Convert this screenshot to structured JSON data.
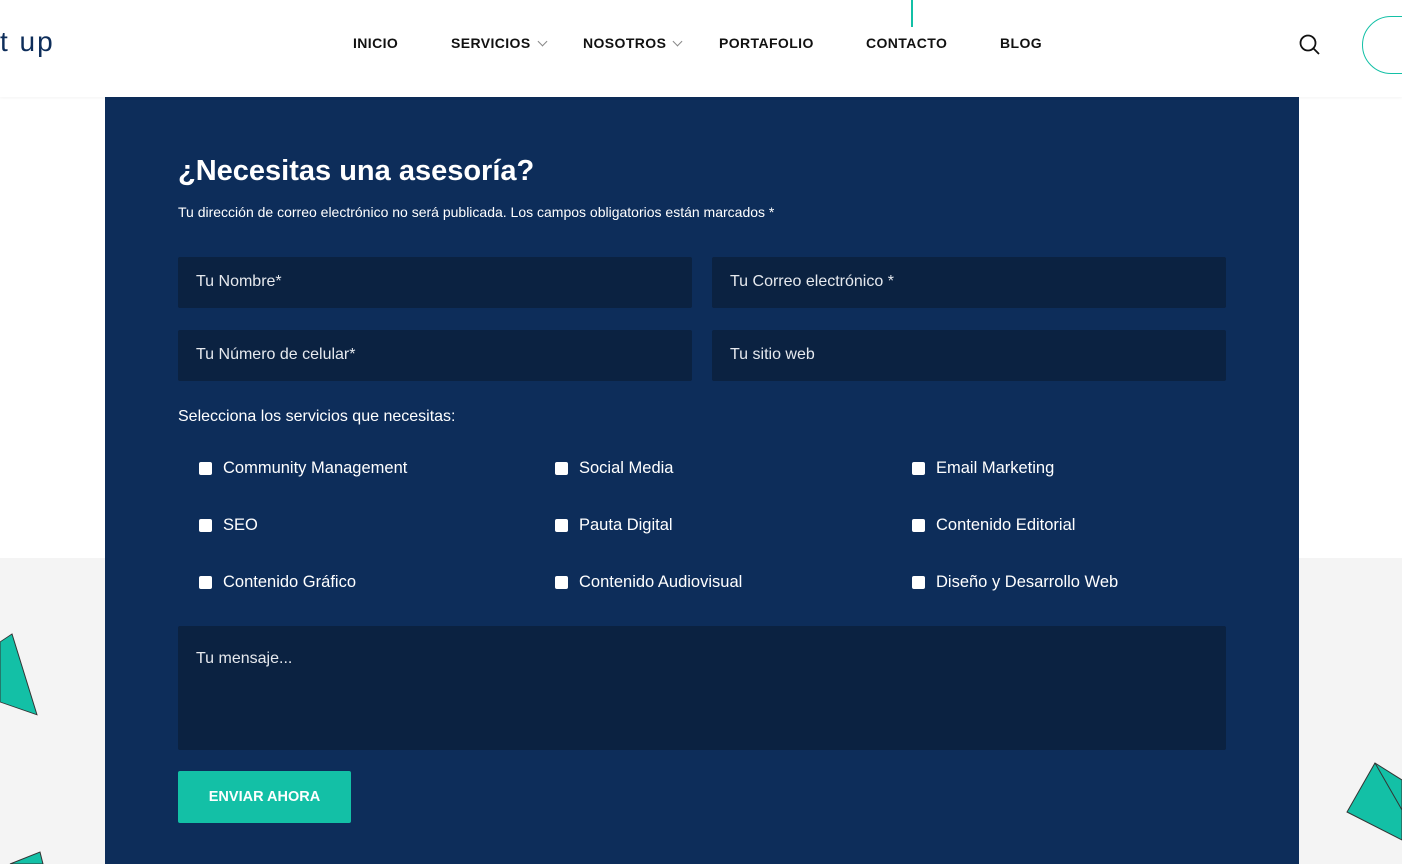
{
  "header": {
    "logo": "t up",
    "nav": [
      {
        "label": "INICIO"
      },
      {
        "label": "SERVICIOS"
      },
      {
        "label": "NOSOTROS"
      },
      {
        "label": "PORTAFOLIO"
      },
      {
        "label": "CONTACTO"
      },
      {
        "label": "BLOG"
      }
    ]
  },
  "form": {
    "title": "¿Necesitas una asesoría?",
    "note": "Tu dirección de correo electrónico no será publicada. Los campos obligatorios están marcados *",
    "name_placeholder": "Tu Nombre*",
    "email_placeholder": "Tu Correo electrónico *",
    "phone_placeholder": "Tu Número de celular*",
    "web_placeholder": "Tu sitio web",
    "services_label": "Selecciona los servicios que necesitas:",
    "services": [
      "Community Management",
      "Social Media",
      "Email Marketing",
      "SEO",
      "Pauta Digital",
      "Contenido Editorial",
      "Contenido Gráfico",
      "Contenido Audiovisual",
      "Diseño y Desarrollo Web"
    ],
    "message_placeholder": "Tu mensaje...",
    "submit": "ENVIAR AHORA"
  },
  "colors": {
    "panel": "#0d2d5a",
    "field": "#0b2241",
    "accent": "#13c0a6"
  }
}
